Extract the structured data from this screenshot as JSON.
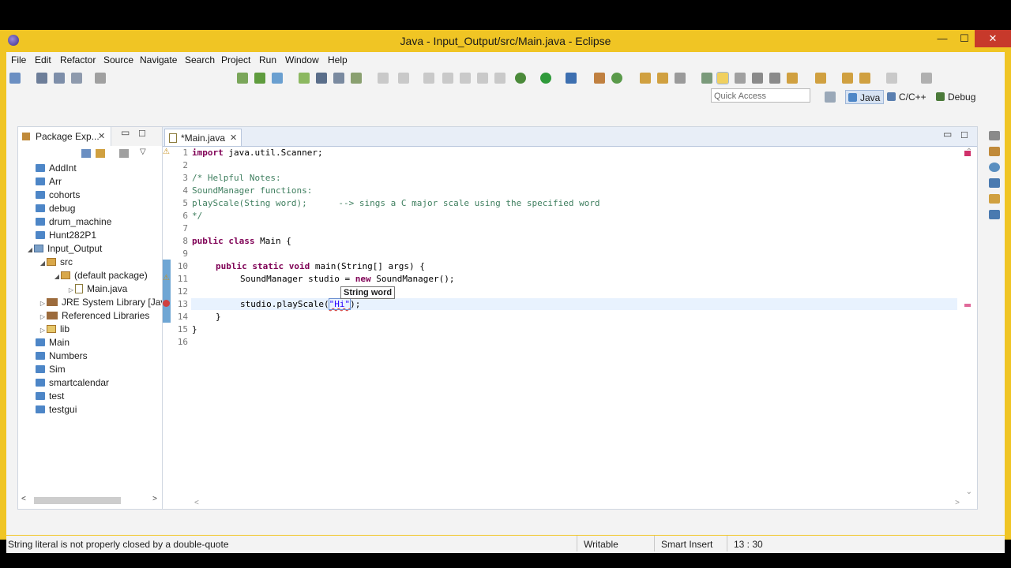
{
  "window": {
    "title": "Java - Input_Output/src/Main.java - Eclipse",
    "minimize": "—",
    "maximize": "☐",
    "close": "✕"
  },
  "menu": [
    "File",
    "Edit",
    "Refactor",
    "Source",
    "Navigate",
    "Search",
    "Project",
    "Run",
    "Window",
    "Help"
  ],
  "toolbar": {
    "quick_access_placeholder": "Quick Access",
    "perspectives": [
      "Java",
      "C/C++",
      "Debug"
    ]
  },
  "package_explorer": {
    "tab_label": "Package Exp...",
    "items": [
      "AddInt",
      "Arr",
      "cohorts",
      "debug",
      "drum_machine",
      "Hunt282P1",
      "Input_Output",
      "src",
      "(default package)",
      "Main.java",
      "JRE System Library [JavaSE",
      "Referenced Libraries",
      "lib",
      "Main",
      "Numbers",
      "Sim",
      "smartcalendar",
      "test",
      "testgui"
    ]
  },
  "editor": {
    "tab_label": "*Main.java",
    "line_numbers": [
      "1",
      "2",
      "3",
      "4",
      "5",
      "6",
      "7",
      "8",
      "9",
      "10",
      "11",
      "12",
      "13",
      "14",
      "15",
      "16"
    ],
    "lines": {
      "l1_kw": "import",
      "l1_rest": " java.util.Scanner;",
      "l3": "/* Helpful Notes:",
      "l4": "SoundManager functions:",
      "l5": "playScale(Sting word);      --> sings a C major scale using the specified word",
      "l6": "*/",
      "l8_kw": "public class",
      "l8_rest": " Main {",
      "l10_kw": "public static void",
      "l10_rest": " main(String[] args) {",
      "l11_a": "SoundManager studio = ",
      "l11_kw": "new",
      "l11_b": " SoundManager();",
      "l13_a": "studio.playScale(",
      "l13_str": "\"Hi\"",
      "l13_b": ");",
      "l14": "}",
      "l15": "}"
    },
    "tooltip": "String word"
  },
  "status": {
    "message": "String literal is not properly closed by a double-quote",
    "writable": "Writable",
    "insert_mode": "Smart Insert",
    "position": "13 : 30"
  },
  "colors": {
    "titlebar": "#f0c524",
    "keyword": "#7f0055",
    "comment": "#3f7f5f",
    "string": "#2a00ff"
  }
}
